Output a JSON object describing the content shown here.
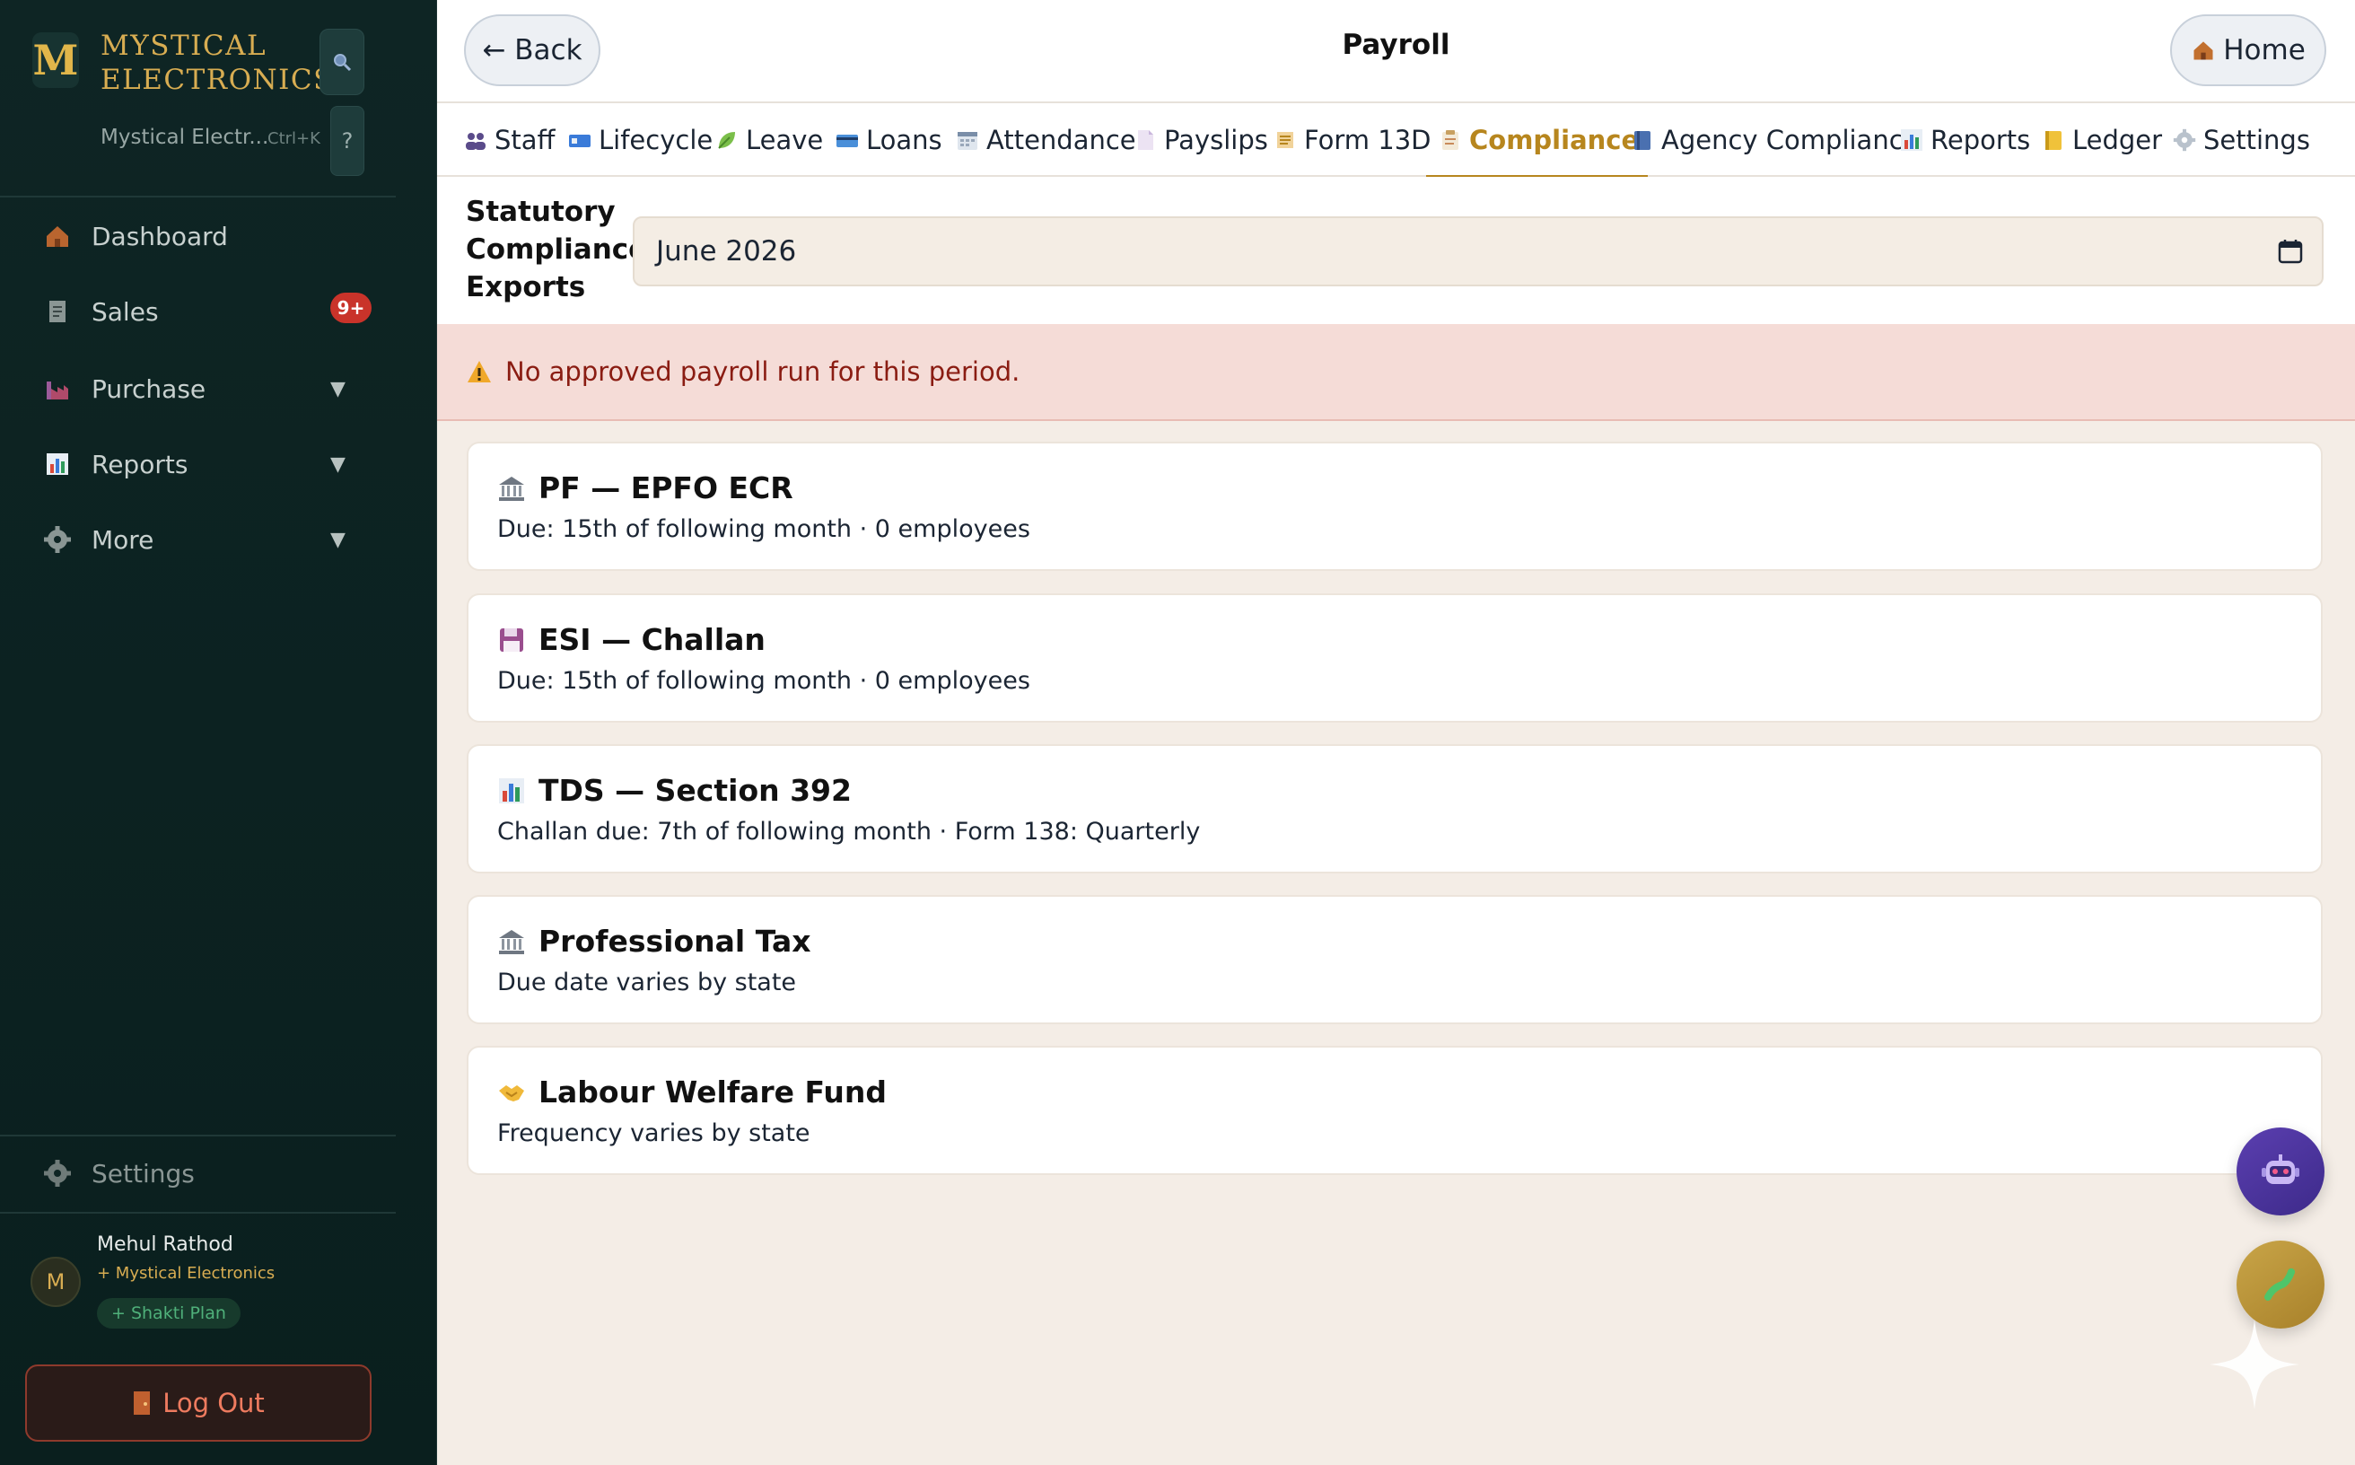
{
  "sidebar": {
    "brand_letter": "M",
    "brand_line1": "MYSTICAL",
    "brand_line2": "ELECTRONICS",
    "company_switch": "Mystical Electr...",
    "shortcut": "Ctrl+K",
    "help": "?",
    "items": [
      {
        "label": "Dashboard",
        "icon": "house-icon"
      },
      {
        "label": "Sales",
        "icon": "receipt-icon",
        "badge": "9+"
      },
      {
        "label": "Purchase",
        "icon": "factory-icon",
        "caret": "▼"
      },
      {
        "label": "Reports",
        "icon": "bar-chart-icon",
        "caret": "▼"
      },
      {
        "label": "More",
        "icon": "gear-icon",
        "caret": "▼"
      }
    ],
    "settings_label": "Settings",
    "user": {
      "avatar": "M",
      "name": "Mehul Rathod",
      "company": "+ Mystical Electronics",
      "plan": "+ Shakti Plan"
    },
    "logout_label": "Log Out"
  },
  "header": {
    "back_label": "← Back",
    "title": "Payroll",
    "home_label": "Home"
  },
  "tabs": [
    {
      "label": "Staff",
      "icon": "people-icon"
    },
    {
      "label": "Lifecycle",
      "icon": "id-card-icon"
    },
    {
      "label": "Leave",
      "icon": "leaf-icon"
    },
    {
      "label": "Loans",
      "icon": "credit-card-icon"
    },
    {
      "label": "Attendance",
      "icon": "calendar-icon"
    },
    {
      "label": "Payslips",
      "icon": "page-icon"
    },
    {
      "label": "Form 13D",
      "icon": "scroll-icon"
    },
    {
      "label": "Compliance",
      "icon": "clipboard-icon",
      "active": true
    },
    {
      "label": "Agency Compliance",
      "icon": "book-icon"
    },
    {
      "label": "Reports",
      "icon": "bar-chart-icon"
    },
    {
      "label": "Ledger",
      "icon": "ledger-icon"
    },
    {
      "label": "Settings",
      "icon": "gear-icon"
    }
  ],
  "filter": {
    "label": "Statutory Compliance Exports",
    "month_value": "June 2026"
  },
  "alert": {
    "text": "No approved payroll run for this period."
  },
  "cards": [
    {
      "title": "PF — EPFO ECR",
      "subtitle": "Due: 15th of following month · 0 employees",
      "icon": "bank-icon"
    },
    {
      "title": "ESI — Challan",
      "subtitle": "Due: 15th of following month · 0 employees",
      "icon": "floppy-icon"
    },
    {
      "title": "TDS — Section 392",
      "subtitle": "Challan due: 7th of following month · Form 138: Quarterly",
      "icon": "bar-chart-icon"
    },
    {
      "title": "Professional Tax",
      "subtitle": "Due date varies by state",
      "icon": "bank-icon"
    },
    {
      "title": "Labour Welfare Fund",
      "subtitle": "Frequency varies by state",
      "icon": "handshake-icon"
    }
  ],
  "colors": {
    "accent": "#b7861e",
    "sidebar_bg": "#0e2524",
    "alert_bg": "#f5dcd7",
    "alert_text": "#8a1c12",
    "badge": "#c9332a"
  }
}
